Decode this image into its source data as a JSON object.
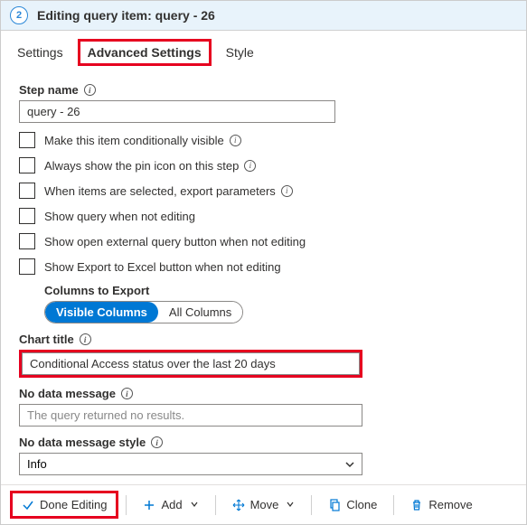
{
  "header": {
    "step_number": "2",
    "title": "Editing query item: query - 26"
  },
  "tabs": {
    "settings": "Settings",
    "advanced": "Advanced Settings",
    "style": "Style"
  },
  "labels": {
    "step_name": "Step name",
    "chart_title": "Chart title",
    "no_data_message": "No data message",
    "no_data_message_style": "No data message style",
    "columns_to_export": "Columns to Export"
  },
  "fields": {
    "step_name_value": "query - 26",
    "chart_title_value": "Conditional Access status over the last 20 days",
    "no_data_message_value": "The query returned no results.",
    "no_data_style_value": "Info"
  },
  "checkboxes": {
    "conditionally_visible": "Make this item conditionally visible",
    "always_pin": "Always show the pin icon on this step",
    "export_params": "When items are selected, export parameters",
    "show_query": "Show query when not editing",
    "show_external": "Show open external query button when not editing",
    "show_excel": "Show Export to Excel button when not editing"
  },
  "pills": {
    "visible": "Visible Columns",
    "all": "All Columns"
  },
  "toolbar": {
    "done": "Done Editing",
    "add": "Add",
    "move": "Move",
    "clone": "Clone",
    "remove": "Remove"
  }
}
